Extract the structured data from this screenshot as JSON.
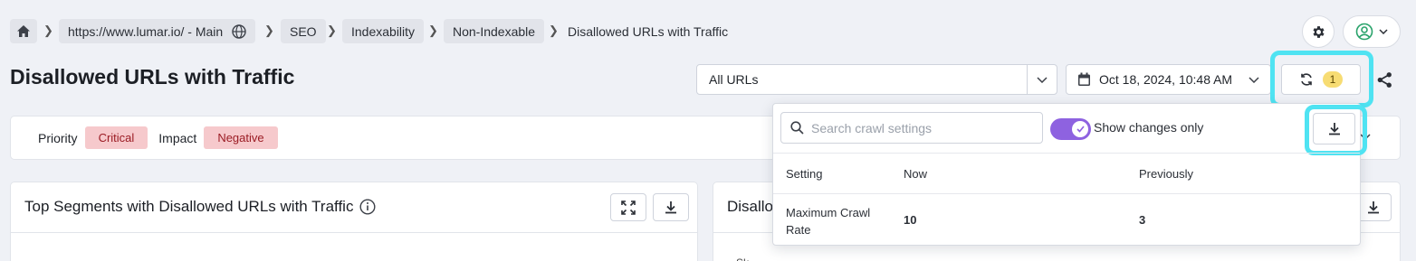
{
  "breadcrumb": {
    "items": [
      "https://www.lumar.io/ - Main",
      "SEO",
      "Indexability",
      "Non-Indexable"
    ],
    "current": "Disallowed URLs with Traffic"
  },
  "page": {
    "title": "Disallowed URLs with Traffic"
  },
  "controls": {
    "segment_select": "All URLs",
    "crawl_date": "Oct 18, 2024, 10:48 AM",
    "changes_count": "1"
  },
  "filters": {
    "priority_label": "Priority",
    "priority_value": "Critical",
    "impact_label": "Impact",
    "impact_value": "Negative"
  },
  "left_card": {
    "title": "Top Segments with Disallowed URLs with Traffic"
  },
  "right_card": {
    "title": "Disallo",
    "axis_fragment": "Sk"
  },
  "popover": {
    "search_placeholder": "Search crawl settings",
    "toggle_label": "Show changes only",
    "toggle_on": true,
    "columns": [
      "Setting",
      "Now",
      "Previously"
    ],
    "rows": [
      {
        "setting": "Maximum Crawl Rate",
        "now": "10",
        "previously": "3"
      }
    ]
  },
  "colors": {
    "accent": "#8e62e0",
    "highlight": "#4fe3f2",
    "tag_bg": "#f6c9cc",
    "badge_bg": "#f7dc73"
  }
}
